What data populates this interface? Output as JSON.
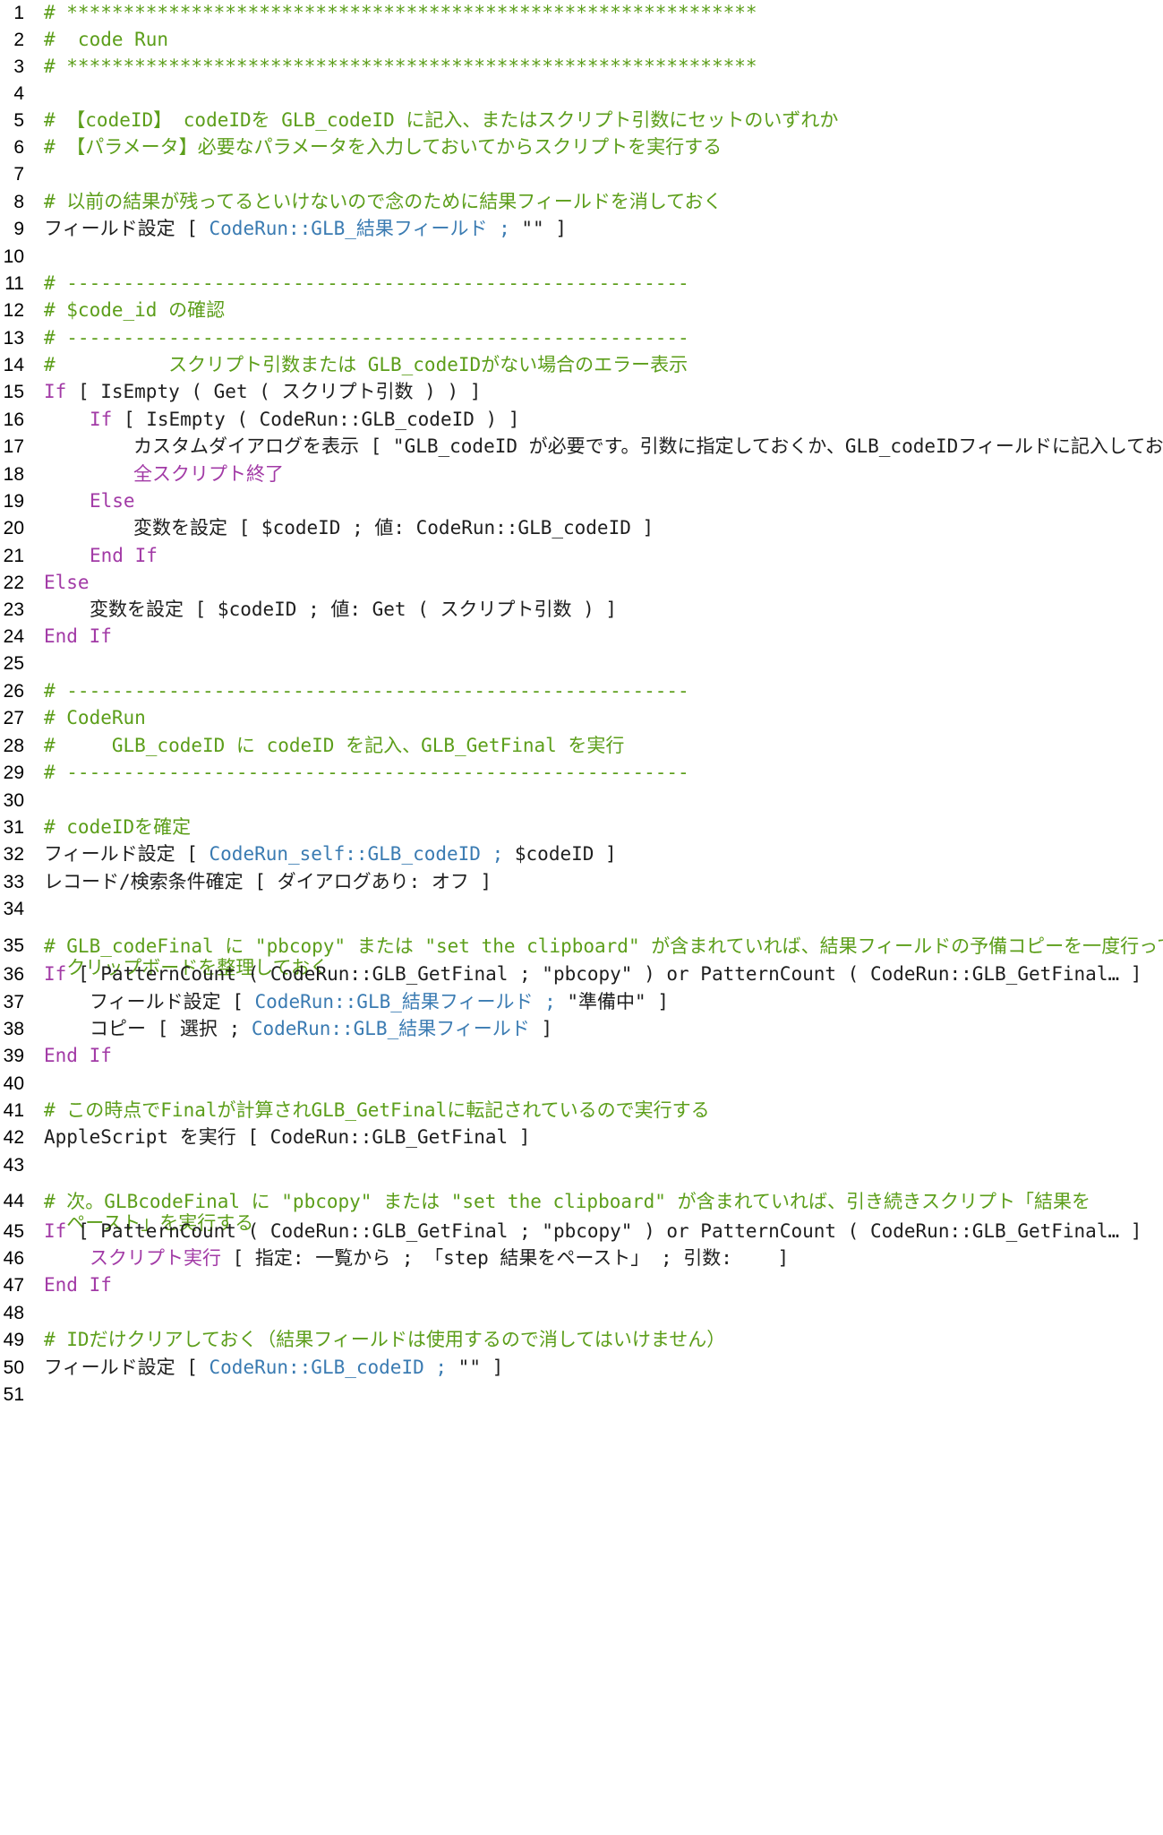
{
  "editor": {
    "lines": [
      {
        "n": "1",
        "tokens": [
          {
            "t": "c",
            "v": "# *************************************************************"
          }
        ]
      },
      {
        "n": "2",
        "tokens": [
          {
            "t": "c",
            "v": "#  code Run"
          }
        ]
      },
      {
        "n": "3",
        "tokens": [
          {
            "t": "c",
            "v": "# *************************************************************"
          }
        ]
      },
      {
        "n": "4",
        "tokens": []
      },
      {
        "n": "5",
        "tokens": [
          {
            "t": "c",
            "v": "# 【codeID】 codeIDを GLB_codeID に記入、またはスクリプト引数にセットのいずれか"
          }
        ]
      },
      {
        "n": "6",
        "tokens": [
          {
            "t": "c",
            "v": "# 【パラメータ】必要なパラメータを入力しておいてからスクリプトを実行する"
          }
        ]
      },
      {
        "n": "7",
        "tokens": []
      },
      {
        "n": "8",
        "tokens": [
          {
            "t": "c",
            "v": "# 以前の結果が残ってるといけないので念のために結果フィールドを消しておく"
          }
        ]
      },
      {
        "n": "9",
        "tokens": [
          {
            "t": "p",
            "v": "フィールド設定 [ "
          },
          {
            "t": "f",
            "v": "CodeRun::GLB_結果フィールド ; "
          },
          {
            "t": "p",
            "v": "\"\" ]"
          }
        ]
      },
      {
        "n": "10",
        "tokens": []
      },
      {
        "n": "11",
        "tokens": [
          {
            "t": "c",
            "v": "# -------------------------------------------------------"
          }
        ]
      },
      {
        "n": "12",
        "tokens": [
          {
            "t": "c",
            "v": "# $code_id の確認"
          }
        ]
      },
      {
        "n": "13",
        "tokens": [
          {
            "t": "c",
            "v": "# -------------------------------------------------------"
          }
        ]
      },
      {
        "n": "14",
        "tokens": [
          {
            "t": "c",
            "v": "#          スクリプト引数または GLB_codeIDがない場合のエラー表示"
          }
        ]
      },
      {
        "n": "15",
        "tokens": [
          {
            "t": "k",
            "v": "If"
          },
          {
            "t": "p",
            "v": " [ IsEmpty ( Get ( スクリプト引数 ) ) ]"
          }
        ]
      },
      {
        "n": "16",
        "indent": 1,
        "tokens": [
          {
            "t": "k",
            "v": "If"
          },
          {
            "t": "p",
            "v": " [ IsEmpty ( CodeRun::GLB_codeID ) ]"
          }
        ]
      },
      {
        "n": "17",
        "indent": 2,
        "tokens": [
          {
            "t": "p",
            "v": "カスタムダイアログを表示 [ \"GLB_codeID が必要です。引数に指定しておくか、GLB_codeIDフィールドに記入しておき"
          }
        ]
      },
      {
        "n": "18",
        "indent": 2,
        "tokens": [
          {
            "t": "k",
            "v": "全スクリプト終了"
          }
        ]
      },
      {
        "n": "19",
        "indent": 1,
        "tokens": [
          {
            "t": "k",
            "v": "Else"
          }
        ]
      },
      {
        "n": "20",
        "indent": 2,
        "tokens": [
          {
            "t": "p",
            "v": "変数を設定 [ $codeID ; 値: CodeRun::GLB_codeID ]"
          }
        ]
      },
      {
        "n": "21",
        "indent": 1,
        "tokens": [
          {
            "t": "k",
            "v": "End If"
          }
        ]
      },
      {
        "n": "22",
        "tokens": [
          {
            "t": "k",
            "v": "Else"
          }
        ]
      },
      {
        "n": "23",
        "indent": 1,
        "tokens": [
          {
            "t": "p",
            "v": "変数を設定 [ $codeID ; 値: Get ( スクリプト引数 ) ]"
          }
        ]
      },
      {
        "n": "24",
        "tokens": [
          {
            "t": "k",
            "v": "End If"
          }
        ]
      },
      {
        "n": "25",
        "tokens": []
      },
      {
        "n": "26",
        "tokens": [
          {
            "t": "c",
            "v": "# -------------------------------------------------------"
          }
        ]
      },
      {
        "n": "27",
        "tokens": [
          {
            "t": "c",
            "v": "# CodeRun"
          }
        ]
      },
      {
        "n": "28",
        "tokens": [
          {
            "t": "c",
            "v": "#     GLB_codeID に codeID を記入、GLB_GetFinal を実行"
          }
        ]
      },
      {
        "n": "29",
        "tokens": [
          {
            "t": "c",
            "v": "# -------------------------------------------------------"
          }
        ]
      },
      {
        "n": "30",
        "tokens": []
      },
      {
        "n": "31",
        "tokens": [
          {
            "t": "c",
            "v": "# codeIDを確定"
          }
        ]
      },
      {
        "n": "32",
        "tokens": [
          {
            "t": "p",
            "v": "フィールド設定 [ "
          },
          {
            "t": "f",
            "v": "CodeRun_self::GLB_codeID ; "
          },
          {
            "t": "p",
            "v": "$codeID ]"
          }
        ]
      },
      {
        "n": "33",
        "tokens": [
          {
            "t": "p",
            "v": "レコード/検索条件確定 [ ダイアログあり: オフ ]"
          }
        ]
      },
      {
        "n": "34",
        "tokens": []
      },
      {
        "n": "35",
        "tall": true,
        "tokens": [
          {
            "t": "c",
            "v": "# GLB_codeFinal に \"pbcopy\" または \"set the clipboard\" が含まれていれば、結果フィールドの予備コピーを一度行って\n  クリップボードを整理しておく"
          }
        ]
      },
      {
        "n": "36",
        "tokens": [
          {
            "t": "k",
            "v": "If"
          },
          {
            "t": "p",
            "v": " [ PatternCount ( CodeRun::GLB_GetFinal ; \"pbcopy\" ) or PatternCount ( CodeRun::GLB_GetFinal… ]"
          }
        ]
      },
      {
        "n": "37",
        "indent": 1,
        "tokens": [
          {
            "t": "p",
            "v": "フィールド設定 [ "
          },
          {
            "t": "f",
            "v": "CodeRun::GLB_結果フィールド ; "
          },
          {
            "t": "p",
            "v": "\"準備中\" ]"
          }
        ]
      },
      {
        "n": "38",
        "indent": 1,
        "tokens": [
          {
            "t": "p",
            "v": "コピー [ 選択 ; "
          },
          {
            "t": "f",
            "v": "CodeRun::GLB_結果フィールド "
          },
          {
            "t": "p",
            "v": "]"
          }
        ]
      },
      {
        "n": "39",
        "tokens": [
          {
            "t": "k",
            "v": "End If"
          }
        ]
      },
      {
        "n": "40",
        "tokens": []
      },
      {
        "n": "41",
        "tokens": [
          {
            "t": "c",
            "v": "# この時点でFinalが計算されGLB_GetFinalに転記されているので実行する"
          }
        ]
      },
      {
        "n": "42",
        "tokens": [
          {
            "t": "p",
            "v": "AppleScript を実行 [ CodeRun::GLB_GetFinal ]"
          }
        ]
      },
      {
        "n": "43",
        "tokens": []
      },
      {
        "n": "44",
        "tall": true,
        "tokens": [
          {
            "t": "c",
            "v": "# 次。GLBcodeFinal に \"pbcopy\" または \"set the clipboard\" が含まれていれば、引き続きスクリプト「結果を\n  ペースト」を実行する"
          }
        ]
      },
      {
        "n": "45",
        "tokens": [
          {
            "t": "k",
            "v": "If"
          },
          {
            "t": "p",
            "v": " [ PatternCount ( CodeRun::GLB_GetFinal ; \"pbcopy\" ) or PatternCount ( CodeRun::GLB_GetFinal… ]"
          }
        ]
      },
      {
        "n": "46",
        "indent": 1,
        "tokens": [
          {
            "t": "k",
            "v": "スクリプト実行"
          },
          {
            "t": "p",
            "v": " [ 指定: 一覧から ; 「step 結果をペースト」 ; 引数:    ]"
          }
        ]
      },
      {
        "n": "47",
        "tokens": [
          {
            "t": "k",
            "v": "End If"
          }
        ]
      },
      {
        "n": "48",
        "tokens": []
      },
      {
        "n": "49",
        "tokens": [
          {
            "t": "c",
            "v": "# IDだけクリアしておく（結果フィールドは使用するので消してはいけません）"
          }
        ]
      },
      {
        "n": "50",
        "tokens": [
          {
            "t": "p",
            "v": "フィールド設定 [ "
          },
          {
            "t": "f",
            "v": "CodeRun::GLB_codeID ; "
          },
          {
            "t": "p",
            "v": "\"\" ]"
          }
        ]
      },
      {
        "n": "51",
        "tokens": []
      }
    ],
    "colors": {
      "comment": "#5c9e1a",
      "keyword": "#a23aa6",
      "field": "#3a7bb2",
      "plain": "#1e1e1e",
      "line_number": "#000000"
    }
  }
}
